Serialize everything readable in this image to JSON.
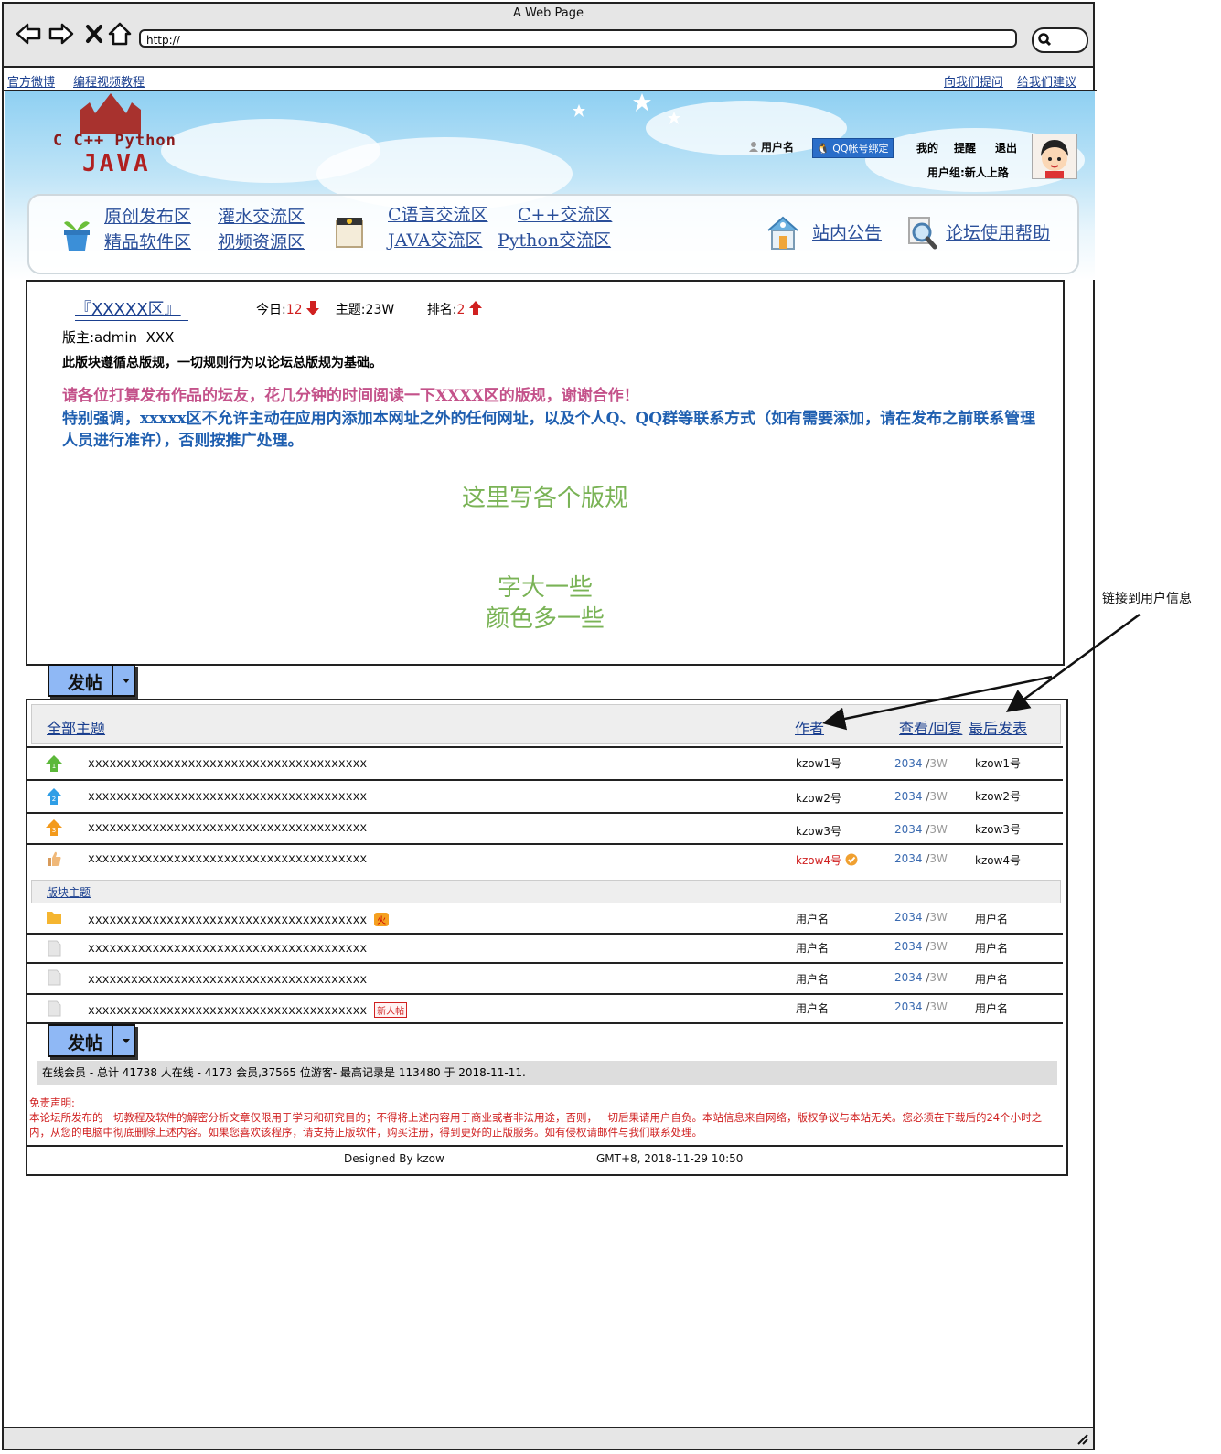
{
  "window": {
    "title": "A Web Page",
    "url": "http://"
  },
  "toplinks": {
    "left": [
      "官方微博",
      "编程视频教程"
    ],
    "right": [
      "向我们提问",
      "给我们建议"
    ]
  },
  "header": {
    "logo_line1": "C C++ Python",
    "logo_line2": "JAVA",
    "username": "用户名",
    "qq_bind": "QQ帐号绑定",
    "my": "我的",
    "remind": "提醒",
    "logout": "退出",
    "usergroup": "用户组:新人上路"
  },
  "nav": {
    "group1": [
      "原创发布区",
      "灌水交流区",
      "精品软件区",
      "视频资源区"
    ],
    "group2": [
      "C语言交流区",
      "C++交流区",
      "JAVA交流区",
      "Python交流区"
    ],
    "announcement": "站内公告",
    "help": "论坛使用帮助"
  },
  "board": {
    "name": "『XXXXX区』",
    "today_label": "今日:",
    "today_value": "12",
    "topics_label": "主题:",
    "topics_value": "23W",
    "rank_label": "排名:",
    "rank_value": "2",
    "moderator": "版主:admin  XXX",
    "rule_line1": "此版块遵循总版规，一切规则行为以论坛总版规为基础。",
    "rule_line2": "请各位打算发布作品的坛友，花几分钟的时间阅读一下XXXX区的版规，谢谢合作！",
    "rule_line3": "特别强调，xxxxx区不允许主动在应用内添加本网址之外的任何网址，以及个人Q、QQ群等联系方式（如有需要添加，请在发布之前联系管理人员进行准许），否则按推广处理。",
    "note1": "这里写各个版规",
    "note2a": "字大一些",
    "note2b": "颜色多一些"
  },
  "post_button": "发帖",
  "table": {
    "col_all": "全部主题",
    "col_author": "作者",
    "col_views": "查看/回复",
    "col_last": "最后发表",
    "section_label": "版块主题",
    "sticky": [
      {
        "title": "xxxxxxxxxxxxxxxxxxxxxxxxxxxxxxxxxxxxxxx",
        "author": "kzow1号",
        "views": "2034",
        "replies": "3W",
        "last": "kzow1号",
        "icon": "green-arrow-1-icon"
      },
      {
        "title": "xxxxxxxxxxxxxxxxxxxxxxxxxxxxxxxxxxxxxxx",
        "author": "kzow2号",
        "views": "2034",
        "replies": "3W",
        "last": "kzow2号",
        "icon": "blue-arrow-2-icon"
      },
      {
        "title": "xxxxxxxxxxxxxxxxxxxxxxxxxxxxxxxxxxxxxxx",
        "author": "kzow3号",
        "views": "2034",
        "replies": "3W",
        "last": "kzow3号",
        "icon": "orange-arrow-3-icon"
      },
      {
        "title": "xxxxxxxxxxxxxxxxxxxxxxxxxxxxxxxxxxxxxxx",
        "author": "kzow4号",
        "views": "2034",
        "replies": "3W",
        "last": "kzow4号",
        "icon": "thumbs-up-icon"
      }
    ],
    "normal": [
      {
        "title": "xxxxxxxxxxxxxxxxxxxxxxxxxxxxxxxxxxxxxxx",
        "author": "用户名",
        "views": "2034",
        "replies": "3W",
        "last": "用户名",
        "badge": "火",
        "icon": "folder-icon"
      },
      {
        "title": "xxxxxxxxxxxxxxxxxxxxxxxxxxxxxxxxxxxxxxx",
        "author": "用户名",
        "views": "2034",
        "replies": "3W",
        "last": "用户名",
        "badge": "",
        "icon": "document-icon"
      },
      {
        "title": "xxxxxxxxxxxxxxxxxxxxxxxxxxxxxxxxxxxxxxx",
        "author": "用户名",
        "views": "2034",
        "replies": "3W",
        "last": "用户名",
        "badge": "",
        "icon": "document-icon"
      },
      {
        "title": "xxxxxxxxxxxxxxxxxxxxxxxxxxxxxxxxxxxxxxx",
        "author": "用户名",
        "views": "2034",
        "replies": "3W",
        "last": "用户名",
        "badge": "新人帖",
        "icon": "document-icon"
      }
    ],
    "sep": "/"
  },
  "online": "在线会员 - 总计 41738 人在线 - 4173 会员,37565 位游客- 最高记录是 113480 于 2018-11-11.",
  "disclaimer": {
    "title": "免责声明:",
    "body": "本论坛所发布的一切教程及软件的解密分析文章仅限用于学习和研究目的；不得将上述内容用于商业或者非法用途，否则，一切后果请用户自负。本站信息来自网络，版权争议与本站无关。您必须在下载后的24个小时之内，从您的电脑中彻底删除上述内容。如果您喜欢该程序，请支持正版软件，购买注册，得到更好的正版服务。如有侵权请邮件与我们联系处理。"
  },
  "footer": {
    "designed": "Designed By kzow",
    "time": "GMT+8, 2018-11-29 10:50"
  },
  "annotation": "链接到用户信息",
  "colors": {
    "link": "#1a3f8f",
    "red": "#d02020",
    "pink": "#c4528a",
    "blue_bold": "#1f5fb0",
    "green": "#7ab356",
    "button": "#8fb8f5"
  }
}
